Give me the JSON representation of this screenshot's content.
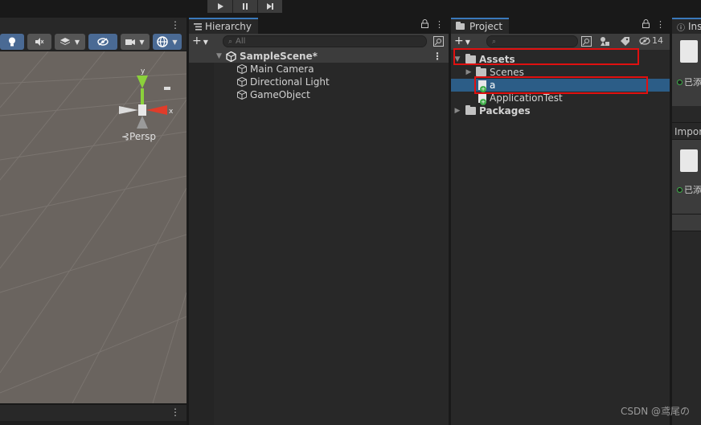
{
  "toolbar": {
    "play_icon": "play-icon",
    "pause_icon": "pause-icon",
    "step_icon": "step-icon"
  },
  "scene": {
    "menu": "⋮",
    "persp_label": "⊰Persp",
    "axis_y": "y",
    "axis_x": "x",
    "bottom_menu": "⋮"
  },
  "hierarchy": {
    "tab_label": "Hierarchy",
    "search_placeholder": "All",
    "scene_name": "SampleScene*",
    "items": [
      {
        "label": "Main Camera"
      },
      {
        "label": "Directional Light"
      },
      {
        "label": "GameObject"
      }
    ]
  },
  "project": {
    "tab_label": "Project",
    "hidden_count": "14",
    "items": {
      "assets": "Assets",
      "scenes": "Scenes",
      "a": "a",
      "application_test": "ApplicationTest",
      "packages": "Packages"
    }
  },
  "inspector": {
    "tab_label": "Ins",
    "added_1": "已添",
    "import_label": "Import",
    "added_2": "已添"
  },
  "watermark": "CSDN @鸢尾の",
  "colors": {
    "selection": "#2c5d87",
    "highlight_box": "#e01010",
    "scene_bg": "#6a645f"
  }
}
